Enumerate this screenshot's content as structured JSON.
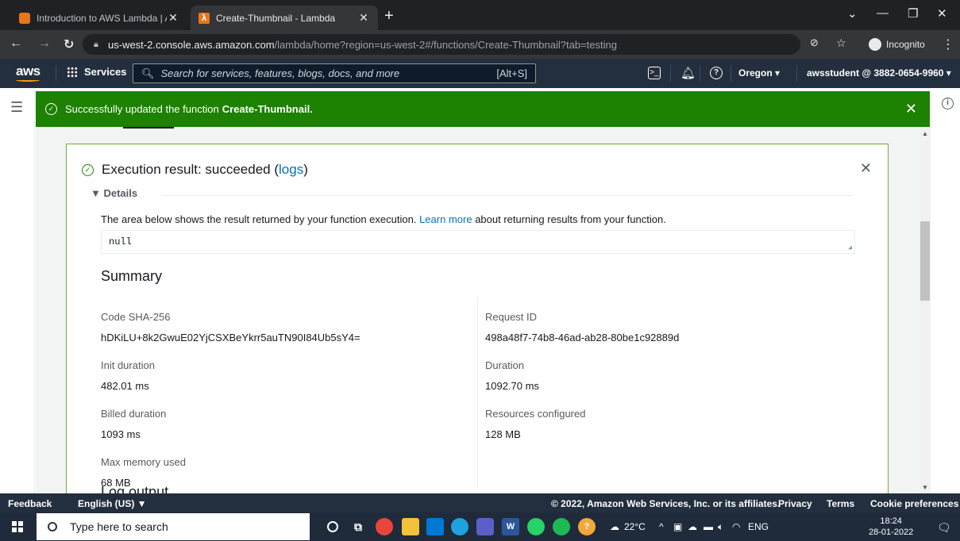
{
  "browser": {
    "tabs": [
      {
        "title": "Introduction to AWS Lambda | A",
        "active": false
      },
      {
        "title": "Create-Thumbnail - Lambda",
        "active": true
      }
    ],
    "url_domain": "us-west-2.console.aws.amazon.com",
    "url_path": "/lambda/home?region=us-west-2#/functions/Create-Thumbnail?tab=testing",
    "incognito_label": "Incognito"
  },
  "aws_nav": {
    "logo": "aws",
    "services_label": "Services",
    "search_placeholder": "Search for services, features, blogs, docs, and more",
    "search_shortcut": "[Alt+S]",
    "region": "Oregon ▾",
    "account": "awsstudent @ 3882-0654-9960 ▾"
  },
  "flash": {
    "message": "Successfully updated the function",
    "function_name": "Create-Thumbnail."
  },
  "result": {
    "title": "Execution result: succeeded (",
    "logs_link": "logs",
    "title_end": ")",
    "details_label": "▼  Details",
    "desc_before": "The area below shows the result returned by your function execution.",
    "learn_more": "Learn more",
    "desc_after": "about returning results from your function.",
    "output": "null",
    "summary_title": "Summary",
    "fields": {
      "code_sha_label": "Code SHA-256",
      "code_sha_value": "hDKiLU+8k2GwuE02YjCSXBeYkrr5auTN90I84Ub5sY4=",
      "request_id_label": "Request ID",
      "request_id_value": "498a48f7-74b8-46ad-ab28-80be1c92889d",
      "init_duration_label": "Init duration",
      "init_duration_value": "482.01 ms",
      "duration_label": "Duration",
      "duration_value": "1092.70 ms",
      "billed_duration_label": "Billed duration",
      "billed_duration_value": "1093 ms",
      "resources_label": "Resources configured",
      "resources_value": "128 MB",
      "max_memory_label": "Max memory used",
      "max_memory_value": "68 MB"
    },
    "log_output_title": "Log output"
  },
  "footer": {
    "feedback": "Feedback",
    "language": "English (US) ▼",
    "copyright": "© 2022, Amazon Web Services, Inc. or its affiliates.",
    "privacy": "Privacy",
    "terms": "Terms",
    "cookies": "Cookie preferences"
  },
  "taskbar": {
    "search_placeholder": "Type here to search",
    "weather": "22°C",
    "language": "ENG",
    "time": "18:24",
    "date": "28-01-2022"
  },
  "colors": {
    "success_green": "#1d8102",
    "aws_nav": "#232f3e",
    "link_blue": "#0073bb"
  }
}
